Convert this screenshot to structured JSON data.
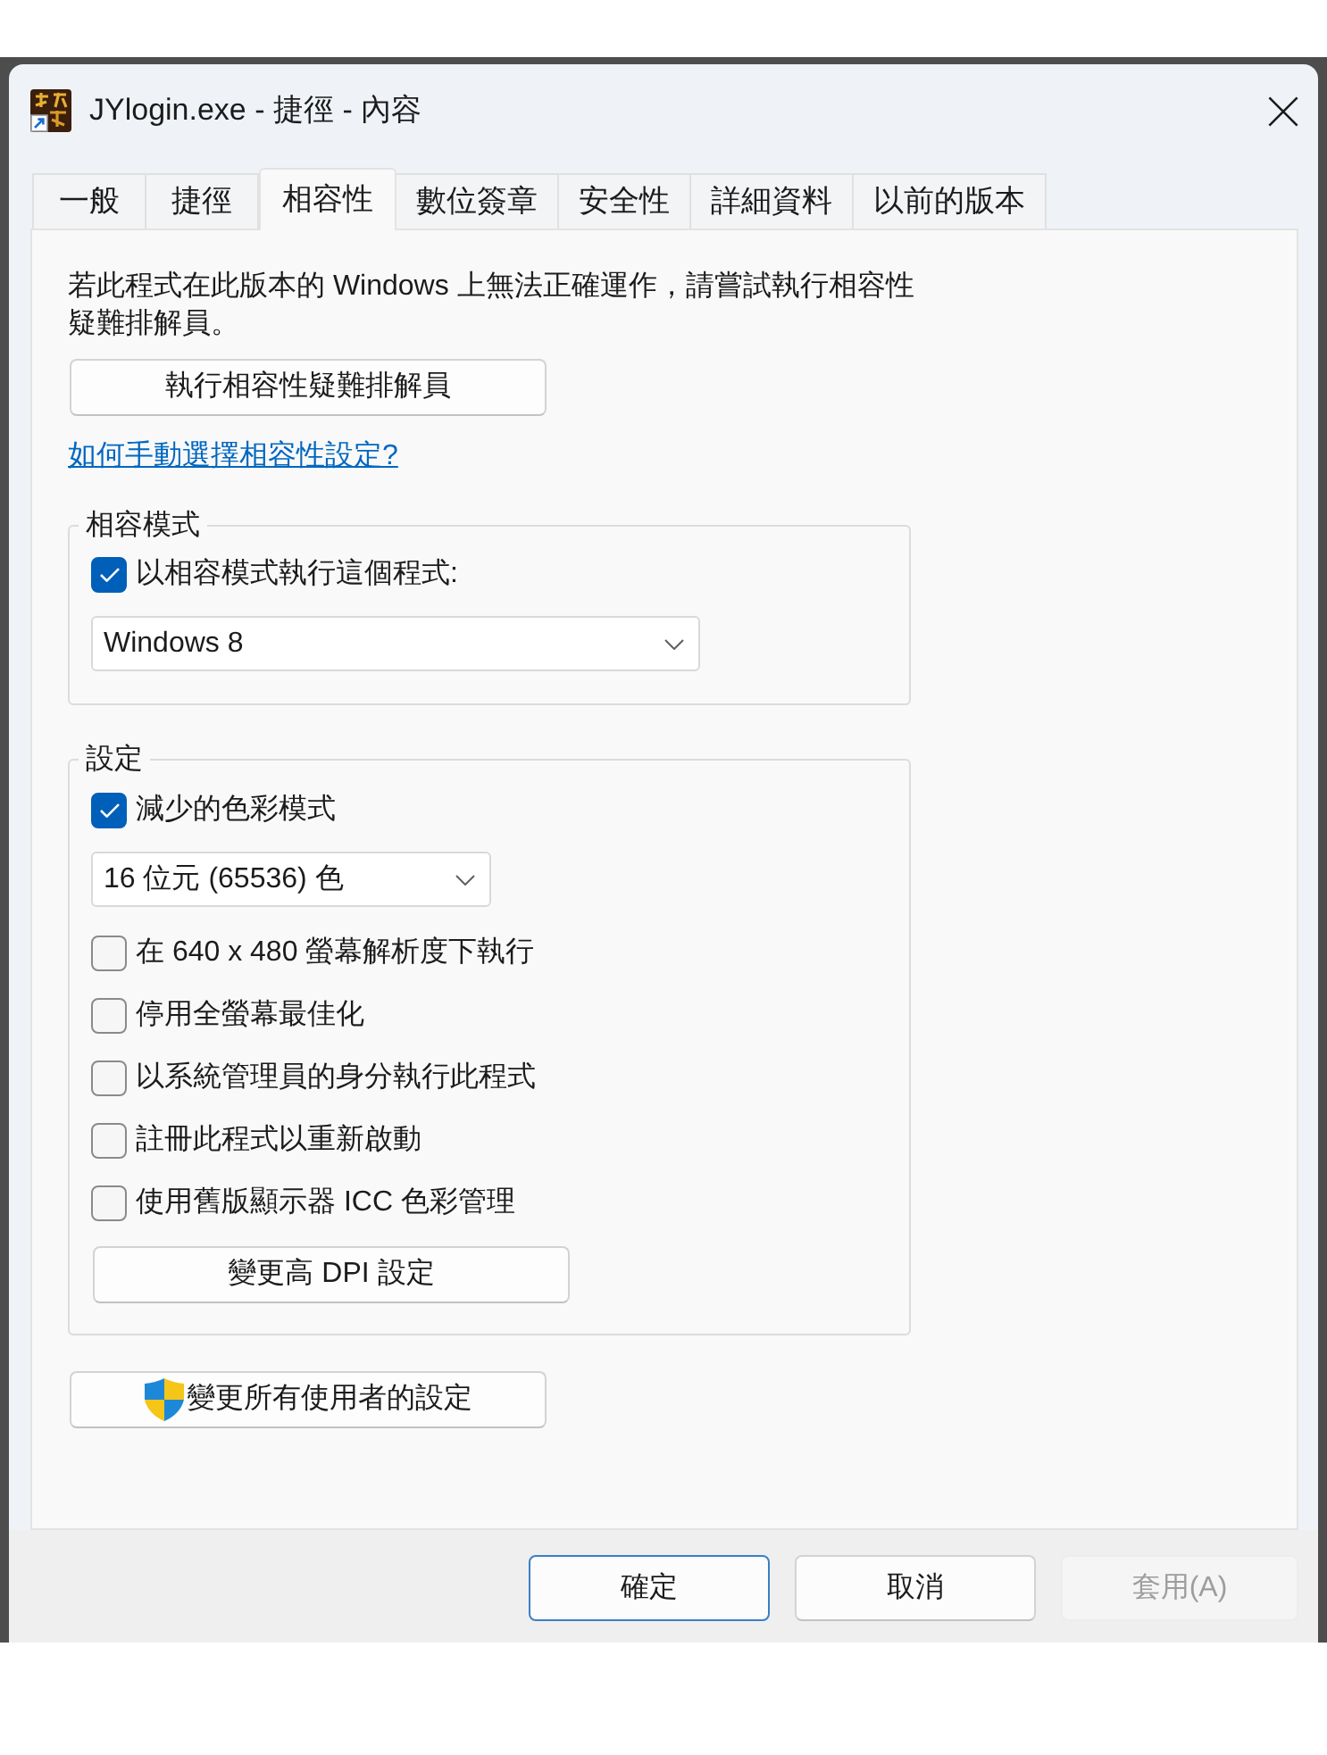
{
  "window": {
    "title": "JYlogin.exe - 捷徑 - 內容"
  },
  "tabs": [
    {
      "label": "一般",
      "selected": false
    },
    {
      "label": "捷徑",
      "selected": false
    },
    {
      "label": "相容性",
      "selected": true
    },
    {
      "label": "數位簽章",
      "selected": false
    },
    {
      "label": "安全性",
      "selected": false
    },
    {
      "label": "詳細資料",
      "selected": false
    },
    {
      "label": "以前的版本",
      "selected": false
    }
  ],
  "compatibility_tab": {
    "intro": "若此程式在此版本的 Windows 上無法正確運作，請嘗試執行相容性疑難排解員。",
    "troubleshooter_button": "執行相容性疑難排解員",
    "help_link": "如何手動選擇相容性設定?",
    "compatibility_mode": {
      "legend": "相容模式",
      "checkbox": {
        "label": "以相容模式執行這個程式:",
        "checked": true
      },
      "dropdown": {
        "value": "Windows 8"
      }
    },
    "settings": {
      "legend": "設定",
      "color_mode": {
        "label": "減少的色彩模式",
        "checked": true
      },
      "color_dropdown": {
        "value": "16 位元 (65536) 色"
      },
      "options": [
        {
          "label": "在 640 x 480 螢幕解析度下執行",
          "checked": false
        },
        {
          "label": "停用全螢幕最佳化",
          "checked": false
        },
        {
          "label": "以系統管理員的身分執行此程式",
          "checked": false
        },
        {
          "label": "註冊此程式以重新啟動",
          "checked": false
        },
        {
          "label": "使用舊版顯示器 ICC 色彩管理",
          "checked": false
        }
      ],
      "dpi_button": "變更高 DPI 設定"
    },
    "all_users_button": "變更所有使用者的設定"
  },
  "dialog_buttons": [
    {
      "label": "確定",
      "default": true,
      "disabled": false
    },
    {
      "label": "取消",
      "default": false,
      "disabled": false
    },
    {
      "label": "套用(A)",
      "default": false,
      "disabled": true
    }
  ]
}
